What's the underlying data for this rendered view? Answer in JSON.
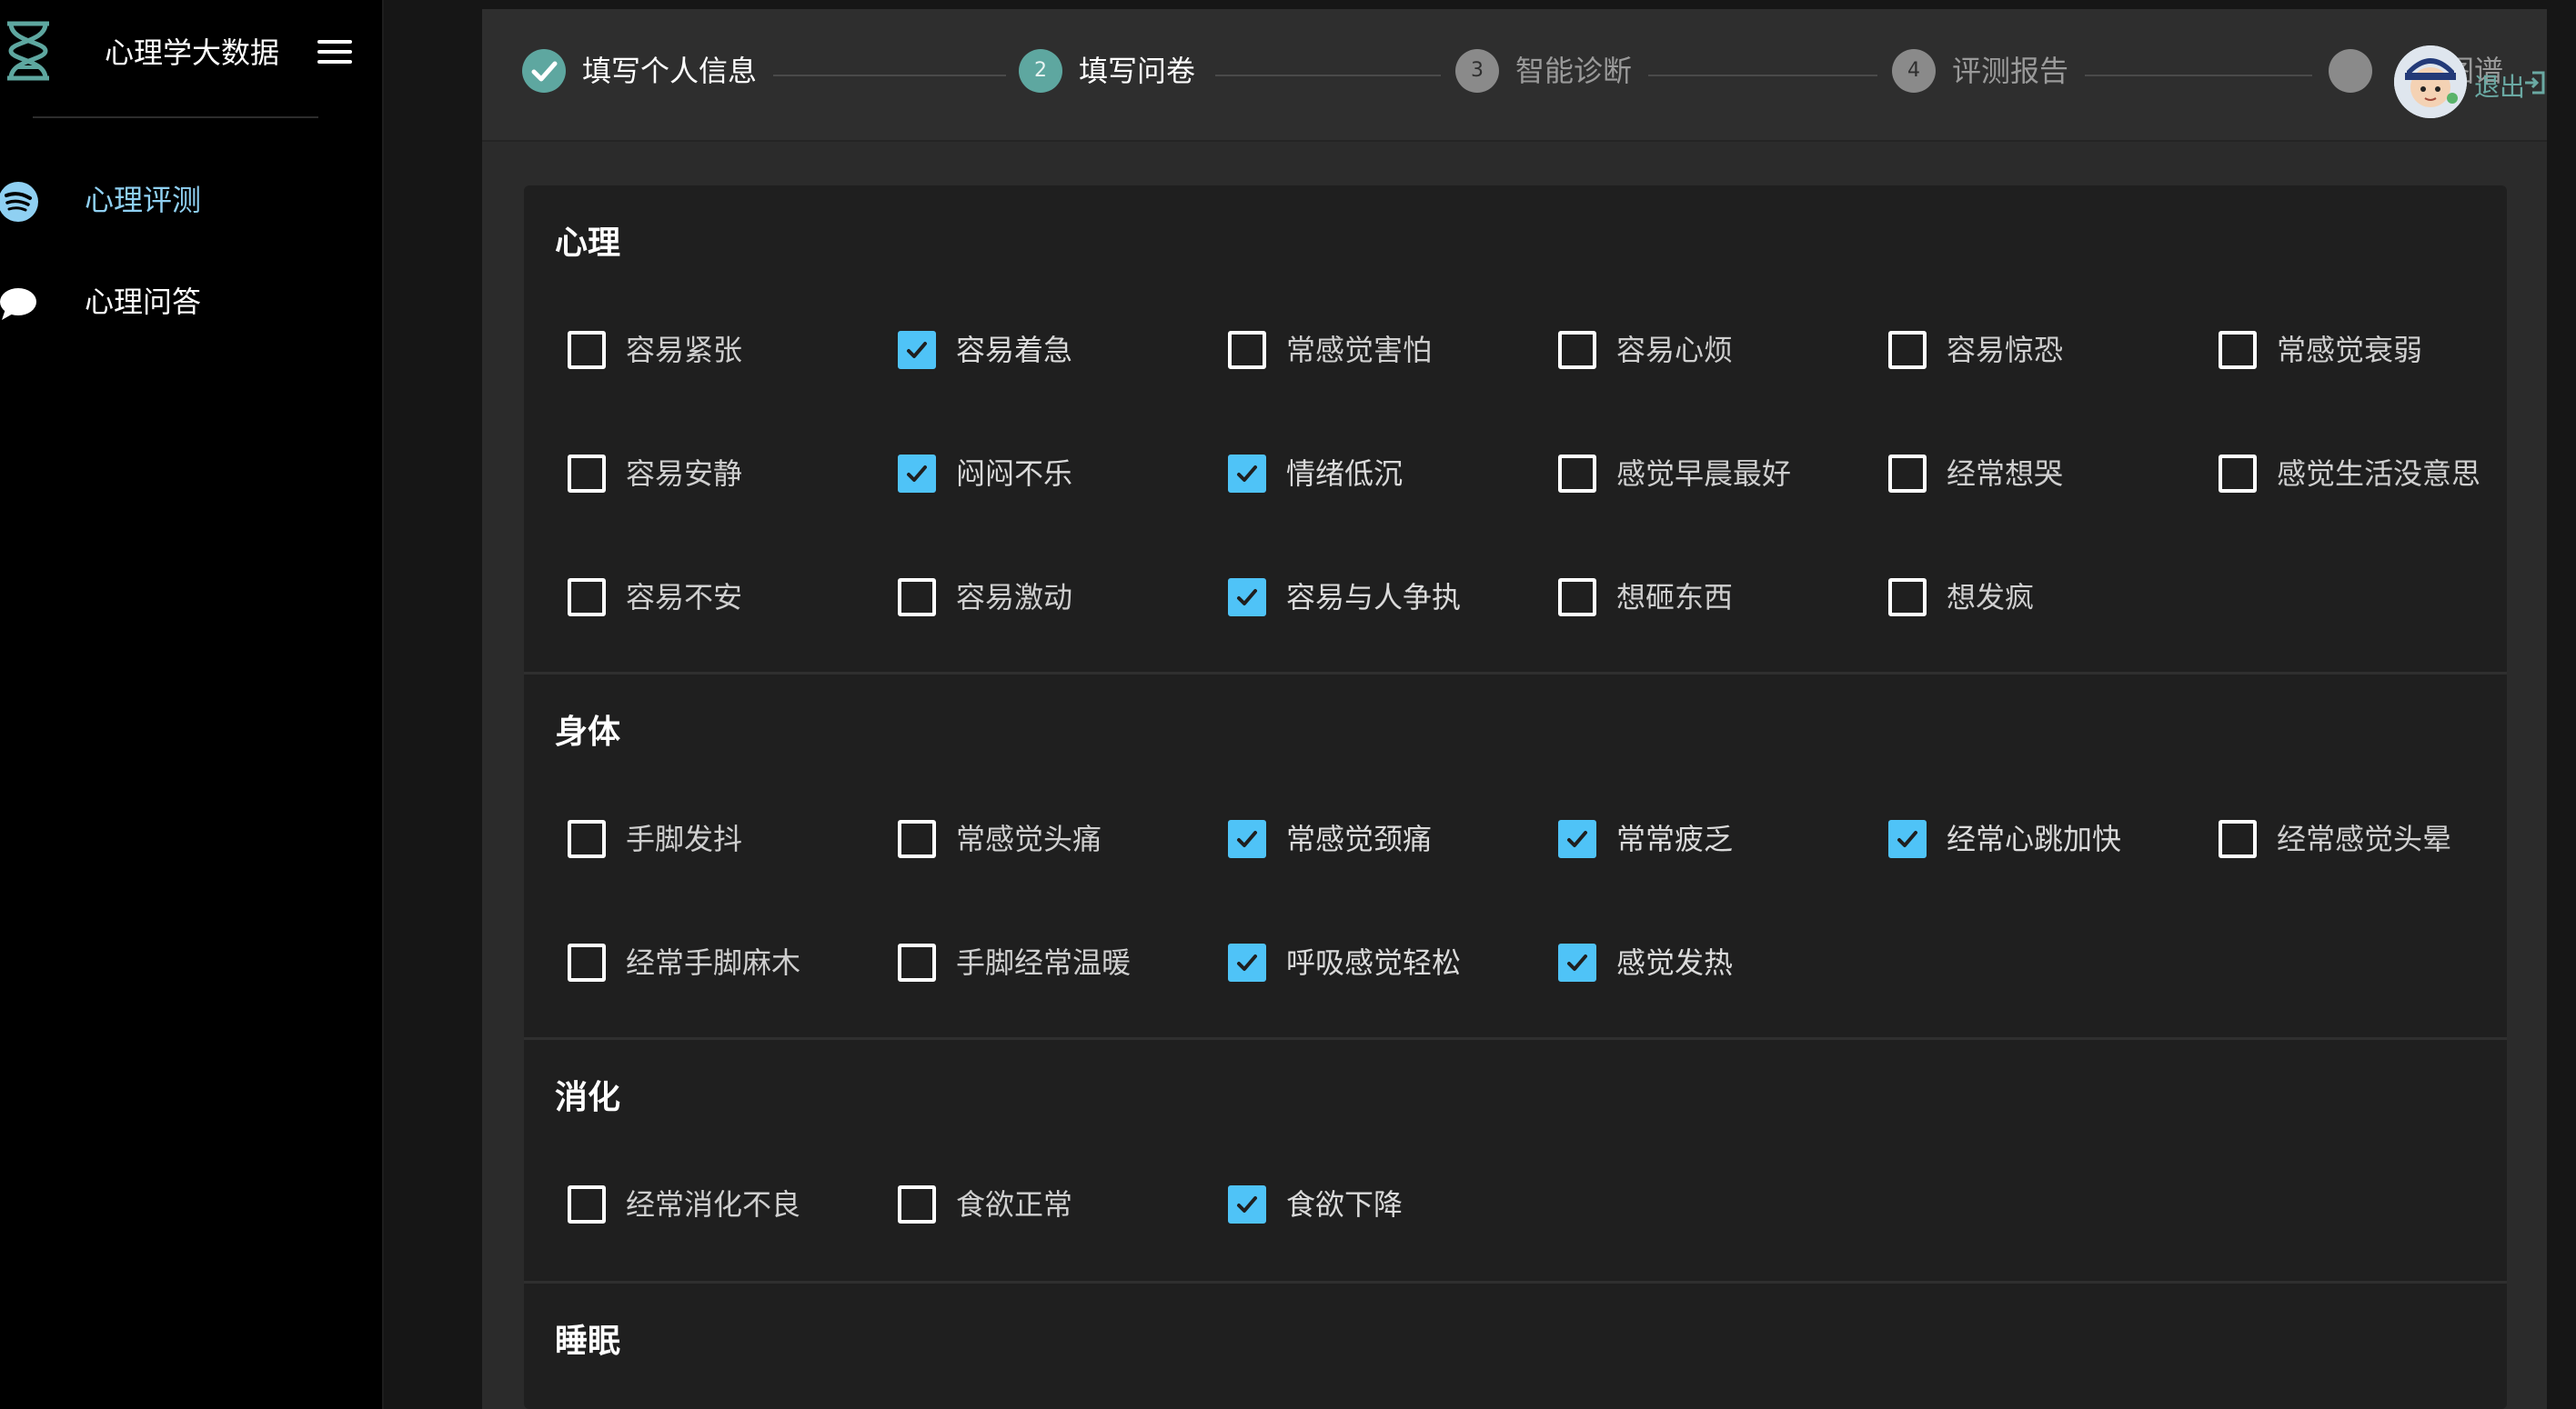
{
  "app": {
    "title": "心理学大数据"
  },
  "sidebar": {
    "items": [
      {
        "label": "心理评测",
        "icon": "spotify-like-sound-icon",
        "active": true
      },
      {
        "label": "心理问答",
        "icon": "speech-bubble-icon",
        "active": false
      }
    ]
  },
  "steps": [
    {
      "index": "",
      "label": "填写个人信息",
      "state": "done"
    },
    {
      "index": "2",
      "label": "填写问卷",
      "state": "current"
    },
    {
      "index": "3",
      "label": "智能诊断",
      "state": "pending"
    },
    {
      "index": "4",
      "label": "评测报告",
      "state": "pending"
    },
    {
      "index": "",
      "label": "识图谱",
      "state": "pending"
    }
  ],
  "header": {
    "logout_label": "退出"
  },
  "colors": {
    "accent": "#4fc3f7",
    "step_done": "#5ea7a0",
    "active_nav": "#8fd0f2"
  },
  "sections": [
    {
      "title": "心理",
      "options": [
        {
          "label": "容易紧张",
          "checked": false
        },
        {
          "label": "容易着急",
          "checked": true
        },
        {
          "label": "常感觉害怕",
          "checked": false
        },
        {
          "label": "容易心烦",
          "checked": false
        },
        {
          "label": "容易惊恐",
          "checked": false
        },
        {
          "label": "常感觉衰弱",
          "checked": false
        },
        {
          "label": "容易安静",
          "checked": false
        },
        {
          "label": "闷闷不乐",
          "checked": true
        },
        {
          "label": "情绪低沉",
          "checked": true
        },
        {
          "label": "感觉早晨最好",
          "checked": false
        },
        {
          "label": "经常想哭",
          "checked": false
        },
        {
          "label": "感觉生活没意思",
          "checked": false
        },
        {
          "label": "容易不安",
          "checked": false
        },
        {
          "label": "容易激动",
          "checked": false
        },
        {
          "label": "容易与人争执",
          "checked": true
        },
        {
          "label": "想砸东西",
          "checked": false
        },
        {
          "label": "想发疯",
          "checked": false
        }
      ]
    },
    {
      "title": "身体",
      "options": [
        {
          "label": "手脚发抖",
          "checked": false
        },
        {
          "label": "常感觉头痛",
          "checked": false
        },
        {
          "label": "常感觉颈痛",
          "checked": true
        },
        {
          "label": "常常疲乏",
          "checked": true
        },
        {
          "label": "经常心跳加快",
          "checked": true
        },
        {
          "label": "经常感觉头晕",
          "checked": false
        },
        {
          "label": "经常手脚麻木",
          "checked": false
        },
        {
          "label": "手脚经常温暖",
          "checked": false
        },
        {
          "label": "呼吸感觉轻松",
          "checked": true
        },
        {
          "label": "感觉发热",
          "checked": true
        }
      ]
    },
    {
      "title": "消化",
      "options": [
        {
          "label": "经常消化不良",
          "checked": false
        },
        {
          "label": "食欲正常",
          "checked": false
        },
        {
          "label": "食欲下降",
          "checked": true
        }
      ]
    },
    {
      "title": "睡眠",
      "options": []
    }
  ]
}
